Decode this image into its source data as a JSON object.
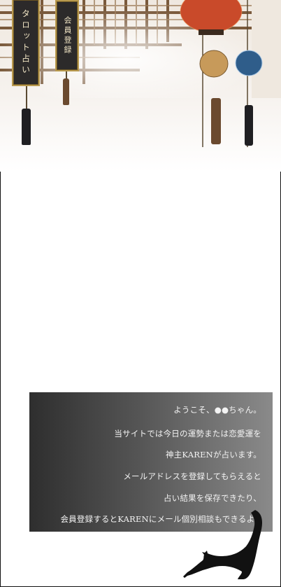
{
  "nav": {
    "tarot_label": "タロット占い",
    "member_label": "会員登録"
  },
  "welcome": {
    "greeting": "ようこそ、●●ちゃん。",
    "lines": [
      "当サイトでは今日の運勢または恋愛運を",
      "神主KARENが占います。",
      "メールアドレスを登録してもらえると",
      "占い結果を保存できたり、",
      "会員登録するとKARENにメール個別相談もできるよ。"
    ]
  },
  "colors": {
    "sign_bg": "#2c2a2a",
    "sign_border": "#b99a4f",
    "lantern_red": "#c94a2a",
    "lantern_blue": "#2f5d8a"
  }
}
